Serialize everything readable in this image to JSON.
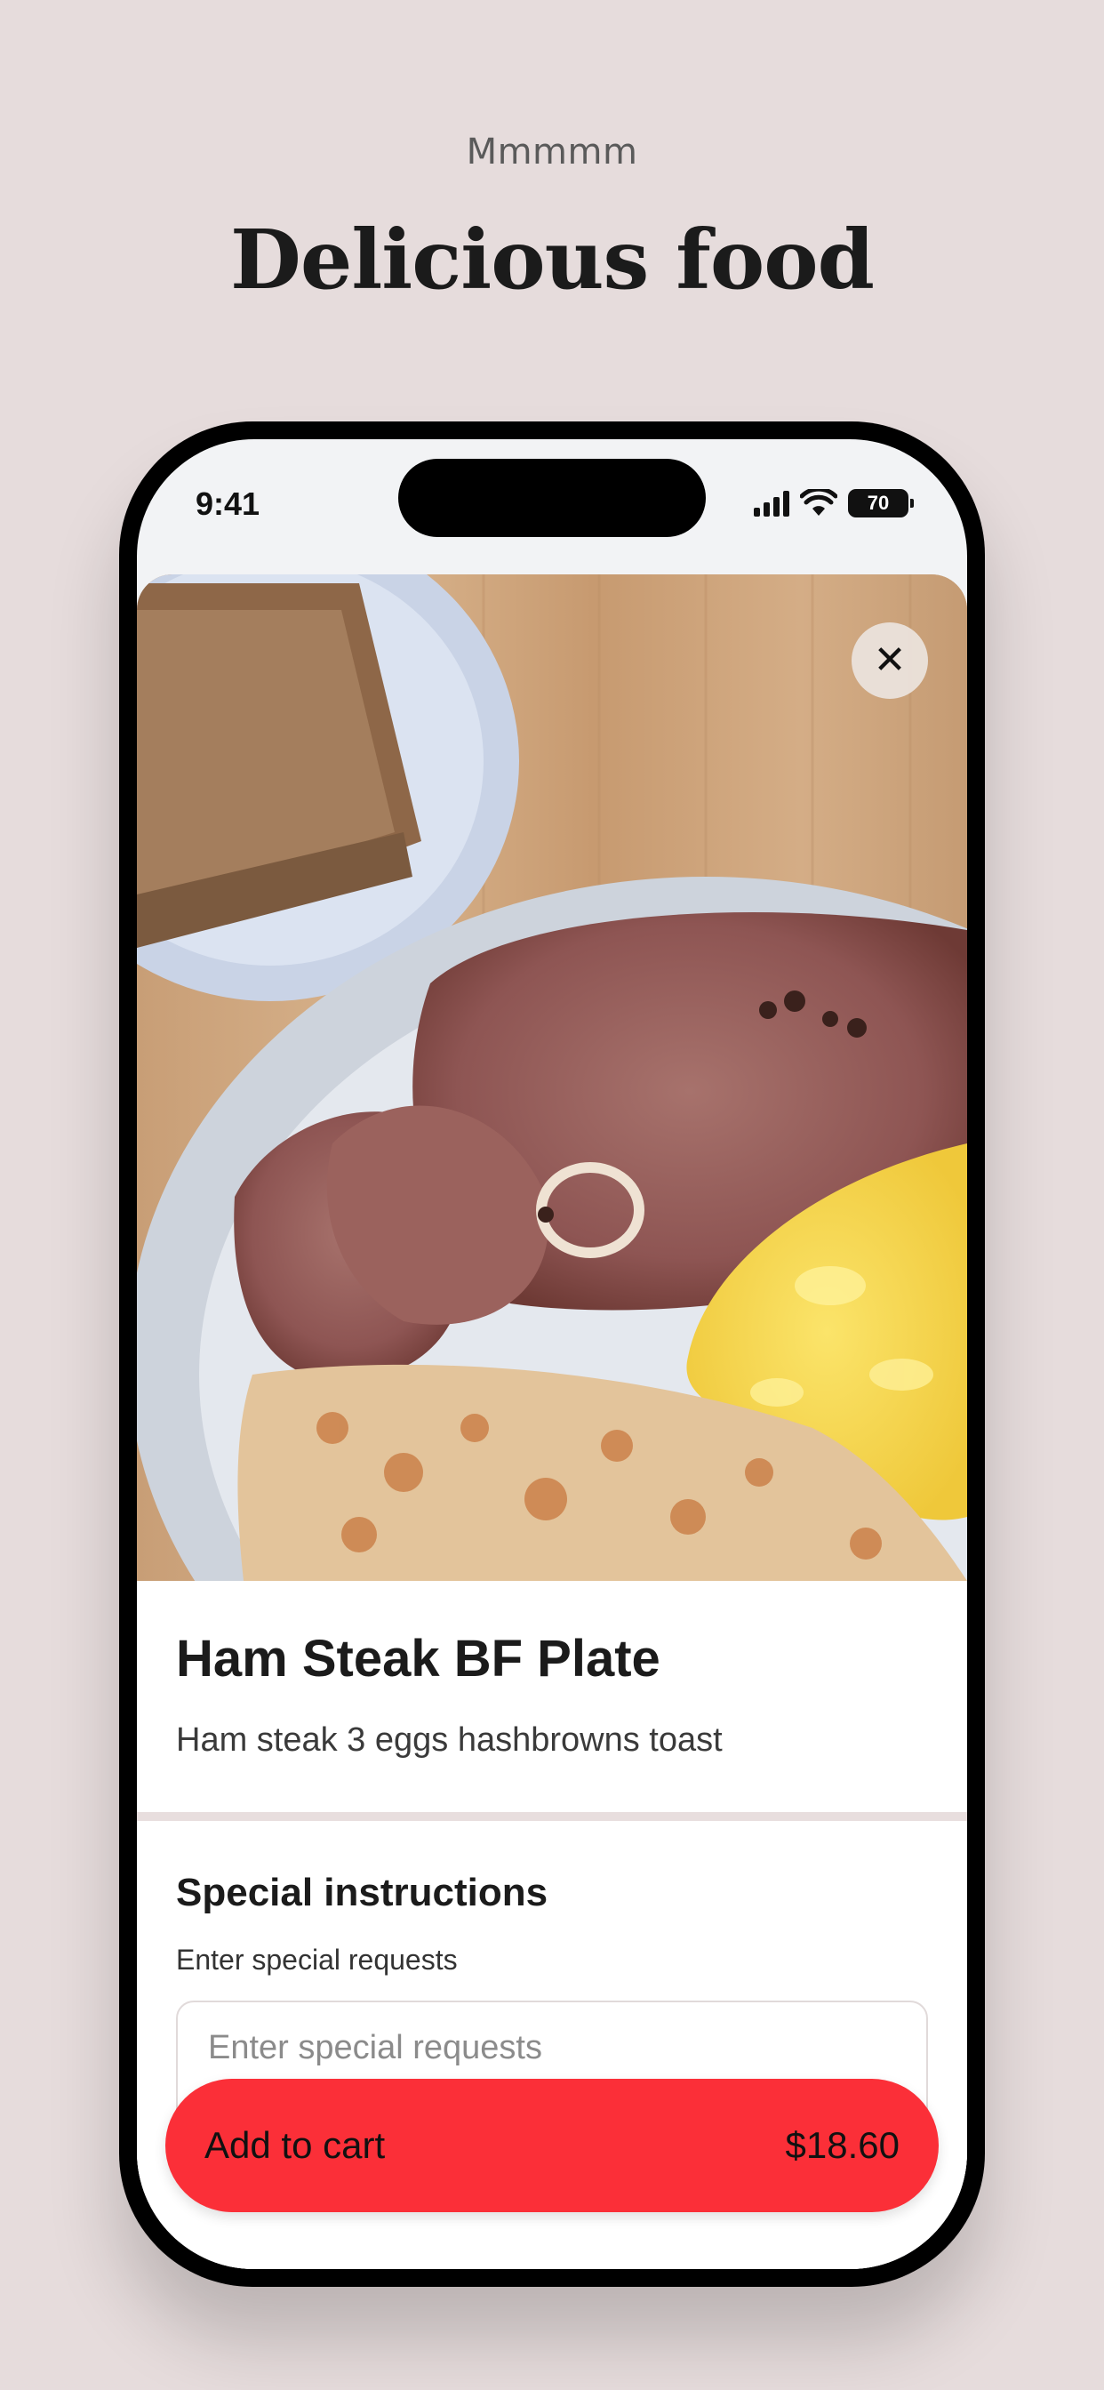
{
  "promo": {
    "kicker": "Mmmmm",
    "title": "Delicious food"
  },
  "status_bar": {
    "time": "9:41",
    "battery": "70",
    "icons": [
      "signal-icon",
      "wifi-icon",
      "battery-icon"
    ]
  },
  "item": {
    "photo_alt": "Ham steak with scrambled eggs, hashbrowns and toast",
    "name": "Ham Steak BF Plate",
    "description": "Ham steak 3 eggs hashbrowns toast",
    "close_icon": "close-icon"
  },
  "special_instructions": {
    "title": "Special instructions",
    "label": "Enter special requests",
    "placeholder": "Enter special requests",
    "value": ""
  },
  "cart_button": {
    "label": "Add to cart",
    "price": "$18.60"
  },
  "colors": {
    "background": "#e6dcdc",
    "accent": "#fb2f38"
  }
}
